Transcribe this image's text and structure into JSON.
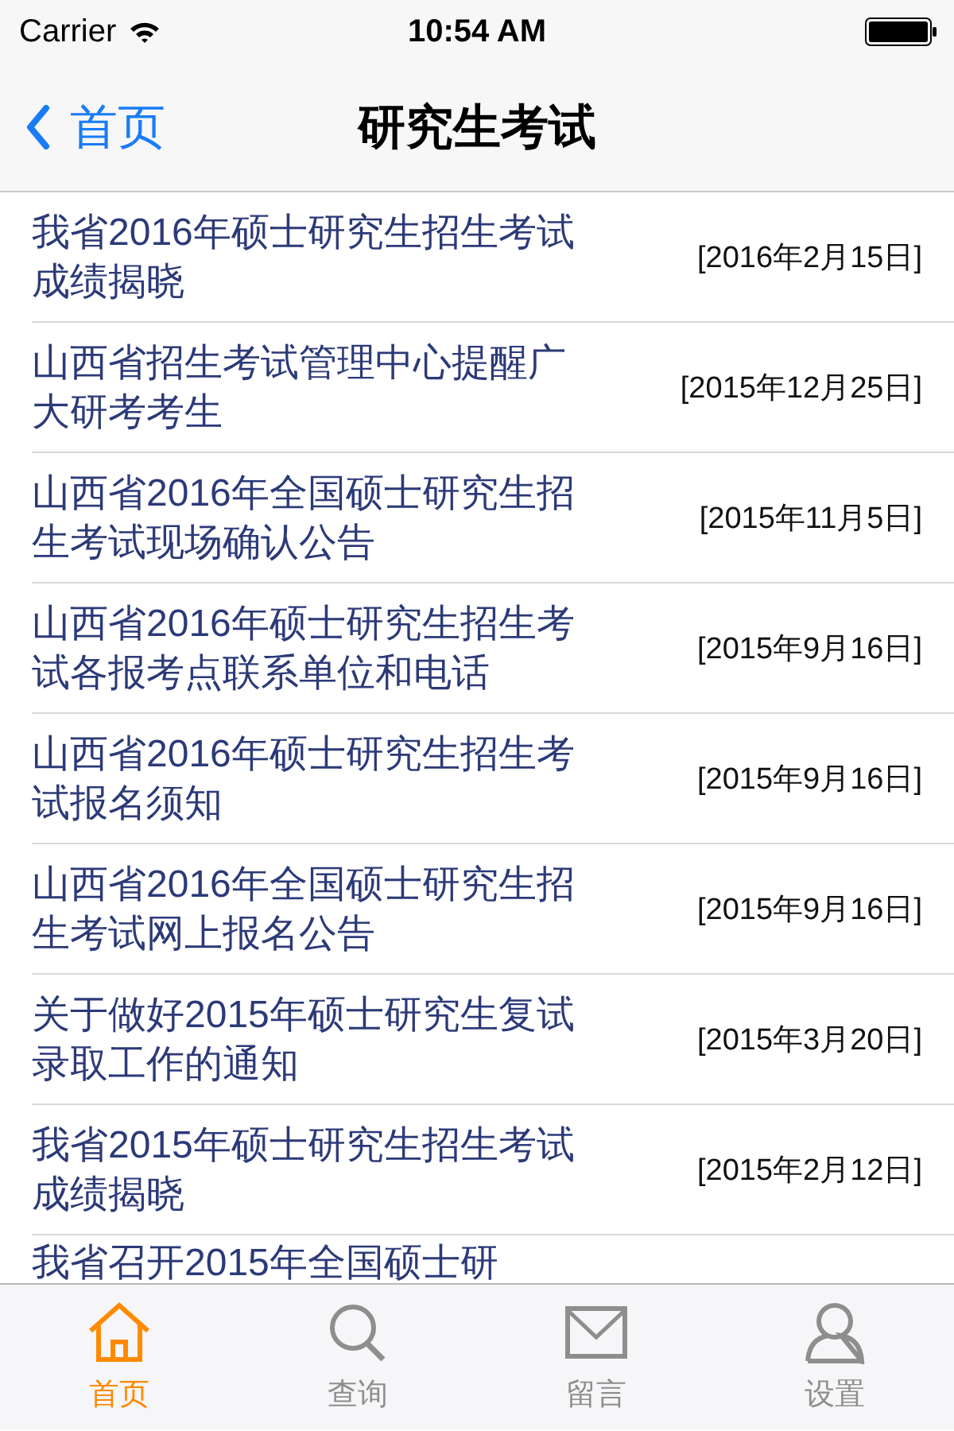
{
  "status_bar": {
    "carrier": "Carrier",
    "time": "10:54 AM"
  },
  "nav": {
    "back": "首页",
    "title": "研究生考试"
  },
  "rows": [
    {
      "title": "我省2016年硕士研究生招生考试成绩揭晓",
      "date": "[2016年2月15日]"
    },
    {
      "title": "山西省招生考试管理中心提醒广大研考考生",
      "date": "[2015年12月25日]"
    },
    {
      "title": "山西省2016年全国硕士研究生招生考试现场确认公告",
      "date": "[2015年11月5日]"
    },
    {
      "title": "山西省2016年硕士研究生招生考试各报考点联系单位和电话",
      "date": "[2015年9月16日]"
    },
    {
      "title": "山西省2016年硕士研究生招生考试报名须知",
      "date": "[2015年9月16日]"
    },
    {
      "title": "山西省2016年全国硕士研究生招生考试网上报名公告",
      "date": "[2015年9月16日]"
    },
    {
      "title": "关于做好2015年硕士研究生复试录取工作的通知",
      "date": "[2015年3月20日]"
    },
    {
      "title": "我省2015年硕士研究生招生考试成绩揭晓",
      "date": "[2015年2月12日]"
    },
    {
      "title": "我省召开2015年全国硕士研"
    }
  ],
  "tabs": [
    {
      "kind": "home",
      "label": "首页",
      "selected": true
    },
    {
      "kind": "search",
      "label": "查询",
      "selected": false
    },
    {
      "kind": "mail",
      "label": "留言",
      "selected": false
    },
    {
      "kind": "user",
      "label": "设置",
      "selected": false
    }
  ]
}
